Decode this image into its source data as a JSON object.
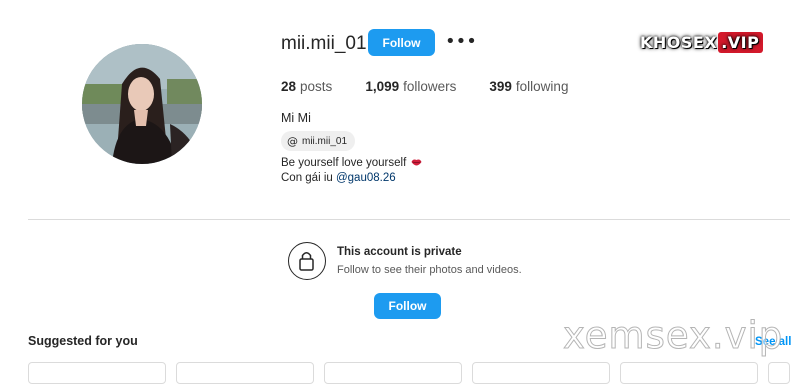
{
  "profile": {
    "username": "mii.mii_01",
    "follow_label": "Follow",
    "more_label": "•••",
    "stats": [
      {
        "value": "28",
        "label": "posts"
      },
      {
        "value": "1,099",
        "label": "followers"
      },
      {
        "value": "399",
        "label": "following"
      }
    ],
    "full_name": "Mi Mi",
    "threads_handle": "mii.mii_01",
    "threads_icon": "@",
    "bio_line1": "Be yourself love yourself",
    "bio_emoji": "🫦",
    "bio_line2_prefix": "Con gái iu ",
    "bio_mention": "@gau08.26"
  },
  "private_notice": {
    "title": "This account is private",
    "subtitle": "Follow to see their photos and videos.",
    "follow_label": "Follow"
  },
  "suggested": {
    "title": "Suggested for you",
    "see_all": "See all"
  },
  "watermarks": {
    "top_main": "KHOSEX",
    "top_vip": ".VIP",
    "bottom": "xemsex.vip"
  },
  "colors": {
    "primary_button": "#1d9bf0",
    "link": "#00376b",
    "see_all": "#0095f6",
    "watermark_vip": "#d3192b"
  }
}
